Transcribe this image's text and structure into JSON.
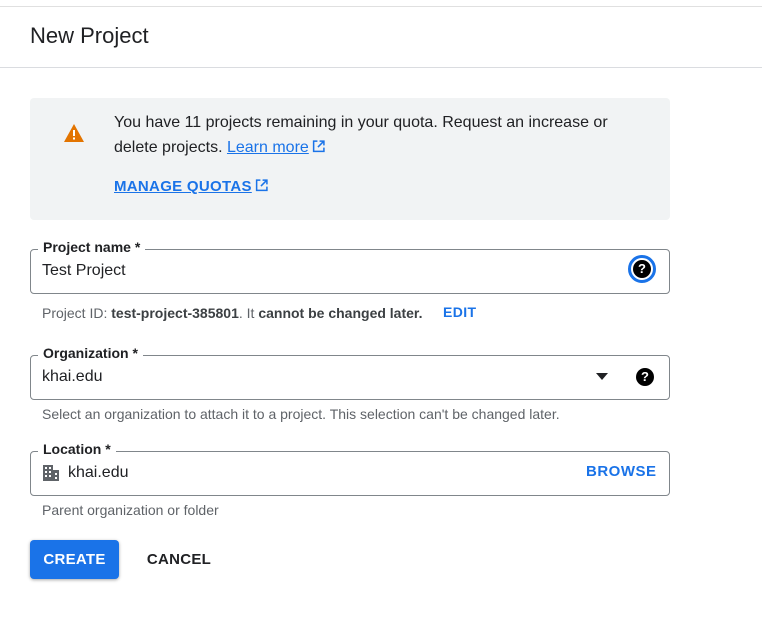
{
  "header": {
    "title": "New Project"
  },
  "alert": {
    "message": "You have 11 projects remaining in your quota. Request an increase or delete projects.",
    "learn_more": "Learn more",
    "manage_quotas": "MANAGE QUOTAS"
  },
  "project_name": {
    "label": "Project name *",
    "value": "Test Project",
    "help_icon": "help-icon"
  },
  "project_id": {
    "prefix": "Project ID: ",
    "id": "test-project-385801",
    "suffix_plain": ". It ",
    "suffix_bold": "cannot be changed later.",
    "edit_label": "EDIT"
  },
  "organization": {
    "label": "Organization *",
    "value": "khai.edu",
    "hint": "Select an organization to attach it to a project. This selection can't be changed later."
  },
  "location": {
    "label": "Location *",
    "value": "khai.edu",
    "browse_label": "BROWSE",
    "hint": "Parent organization or folder"
  },
  "actions": {
    "create": "CREATE",
    "cancel": "CANCEL"
  },
  "colors": {
    "accent": "#1a73e8",
    "warning": "#e37400"
  }
}
